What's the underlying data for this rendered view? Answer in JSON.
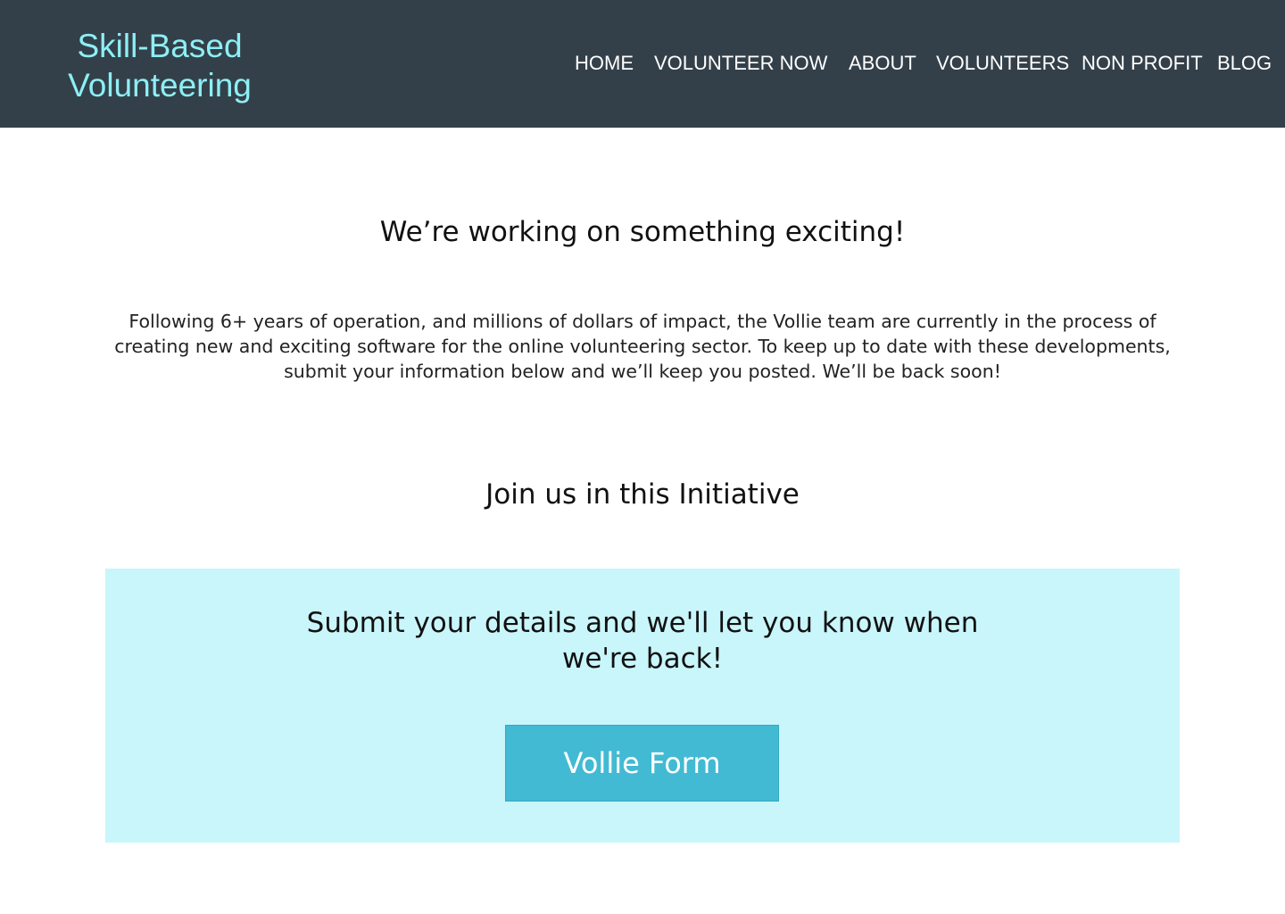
{
  "header": {
    "logo_line1": "Skill-Based",
    "logo_line2": "Volunteering",
    "nav": [
      {
        "label": "HOME"
      },
      {
        "label": "VOLUNTEER NOW"
      },
      {
        "label": "ABOUT"
      },
      {
        "label": "VOLUNTEERS"
      },
      {
        "label": "NON PROFIT"
      },
      {
        "label": "BLOG"
      }
    ]
  },
  "main": {
    "headline": "We’re working on something exciting!",
    "intro_lines": [
      "Following 6+ years of operation, and millions of dollars of impact, the Vollie team are currently in the process of",
      "creating new and exciting software for the online volunteering sector. To keep up to date with these developments,",
      "submit your information below and we’ll keep you posted. We’ll be back soon!"
    ],
    "join_heading": "Join us in this Initiative",
    "cta": {
      "text_line1": "Submit your details and we'll let you know when",
      "text_line2": "we're back!",
      "button_label": "Vollie Form"
    }
  },
  "colors": {
    "header_bg": "#344049",
    "logo": "#8deff5",
    "panel_bg": "#c9f6fb",
    "button_bg": "#42bad3"
  }
}
